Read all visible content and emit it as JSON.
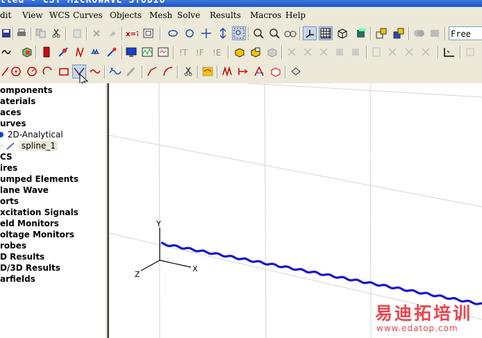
{
  "window": {
    "title": "tled - CST MICROWAVE STUDIO"
  },
  "menu": [
    "dit",
    "View",
    "WCS",
    "Curves",
    "Objects",
    "Mesh",
    "Solve",
    "Results",
    "Macros",
    "Help"
  ],
  "toolbar": {
    "selection_mode": "Free"
  },
  "tree": {
    "items": [
      {
        "label": "omponents",
        "bold": true
      },
      {
        "label": "aterials",
        "bold": true
      },
      {
        "label": "aces",
        "bold": true
      },
      {
        "label": "urves",
        "bold": true
      },
      {
        "label": "2D-Analytical",
        "bold": false
      },
      {
        "label": "spline_1",
        "bold": false,
        "selected": true
      },
      {
        "label": "CS",
        "bold": true
      },
      {
        "label": "ires",
        "bold": true
      },
      {
        "label": "umped Elements",
        "bold": true
      },
      {
        "label": "lane Wave",
        "bold": true
      },
      {
        "label": "orts",
        "bold": true
      },
      {
        "label": "xcitation Signals",
        "bold": true
      },
      {
        "label": "eld Monitors",
        "bold": true
      },
      {
        "label": "oltage Monitors",
        "bold": true
      },
      {
        "label": "robes",
        "bold": true
      },
      {
        "label": "D Results",
        "bold": true
      },
      {
        "label": "D/3D Results",
        "bold": true
      },
      {
        "label": "arfields",
        "bold": true
      }
    ]
  },
  "viewport": {
    "axes": {
      "x": "X",
      "y": "Y",
      "z": "Z"
    },
    "curve_color": "#1414d2"
  },
  "watermark": {
    "line1": "易迪拓培训",
    "line2": "www.edatop.com"
  },
  "colors": {
    "accent": "#1f52c8",
    "watermark": "#e8454e"
  }
}
